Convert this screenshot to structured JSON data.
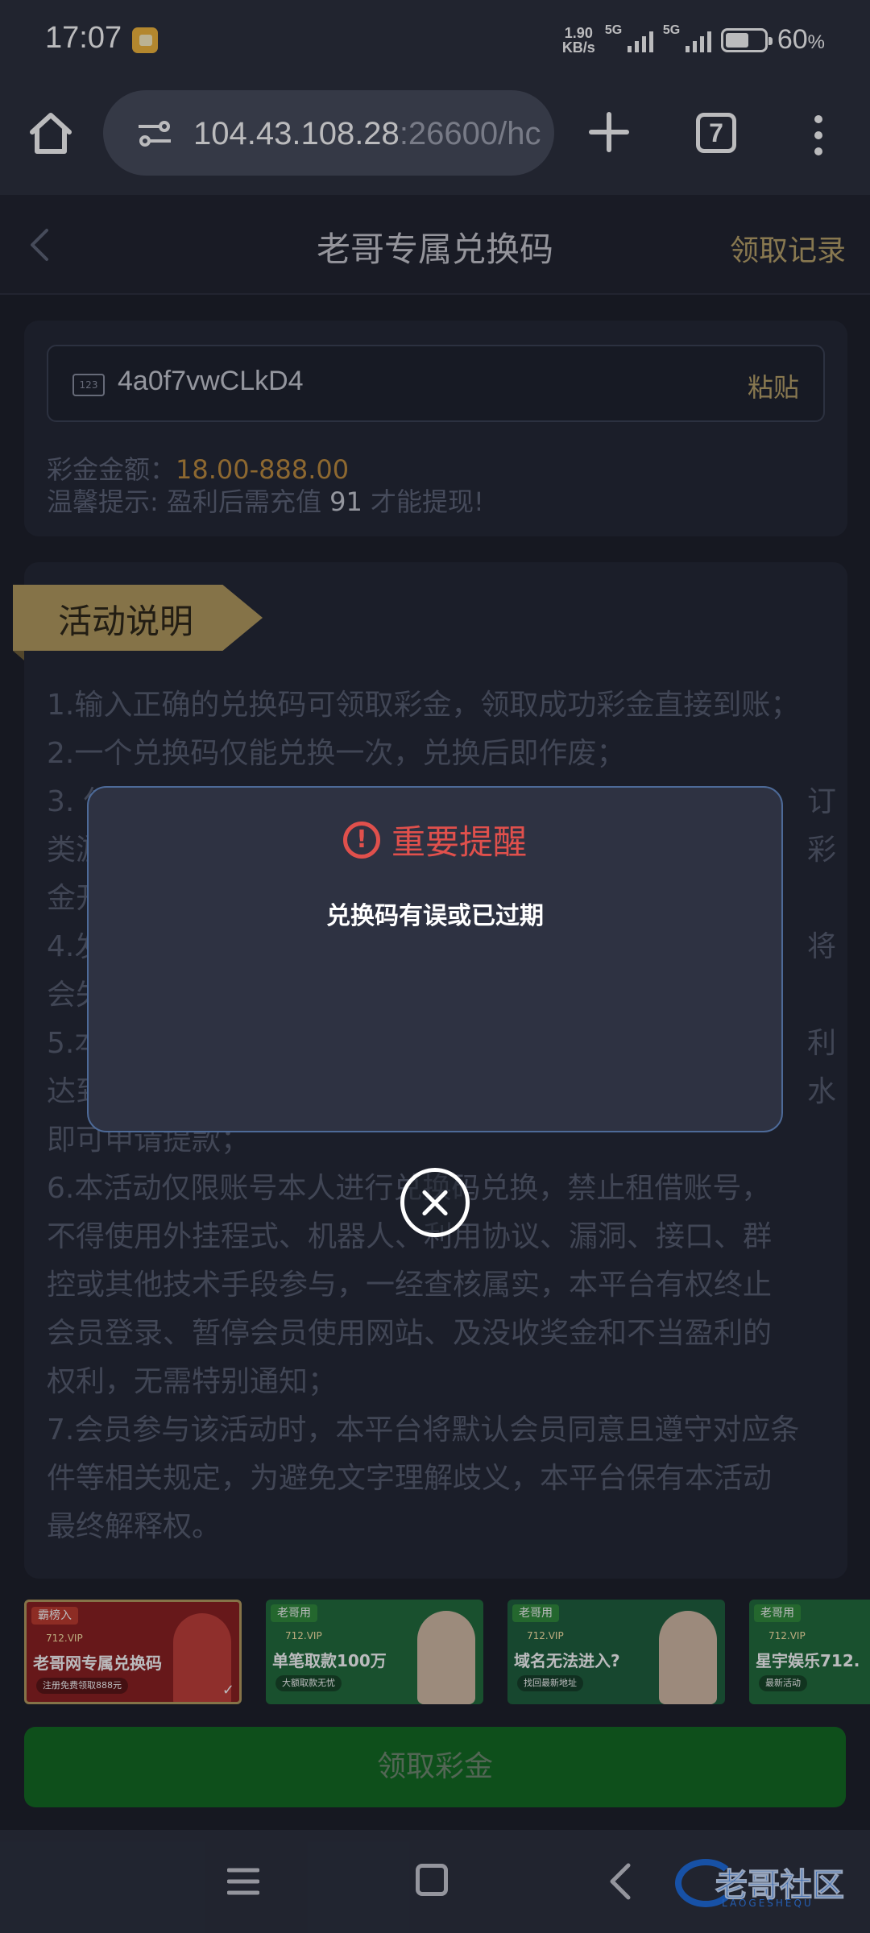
{
  "status_bar": {
    "time": "17:07",
    "net_speed_value": "1.90",
    "net_speed_unit": "KB/s",
    "signal1_label": "5G",
    "signal2_label": "5G",
    "battery_percent": "60",
    "battery_unit": "%"
  },
  "browser": {
    "url_host": "104.43.108.28",
    "url_rest": ":26600/hc",
    "tab_count": "7"
  },
  "header": {
    "title": "老哥专属兑换码",
    "records_link": "领取记录"
  },
  "code_card": {
    "icon_text": "123",
    "code_value": "4a0f7vwCLkD4",
    "paste_label": "粘贴",
    "amount_label": "彩金金额：",
    "amount_value": "18.00-888.00",
    "tip_prefix": "温馨提示: 盈利后需充值 ",
    "tip_number": "91",
    "tip_suffix": " 才能提现!"
  },
  "activity": {
    "ribbon_title": "活动说明",
    "rules": [
      "1.输入正确的兑换码可领取彩金，领取成功彩金直接到账；",
      "2.一个兑换码仅能兑换一次，兑换后即作废；",
      "3. 使",
      "类游",
      "金开",
      "4.发",
      "会失",
      "5.本",
      "达到",
      "即可申请提款；",
      "6.本活动仅限账号本人进行兑换码兑换，禁止租借账号，",
      "不得使用外挂程式、机器人、利用协议、漏洞、接口、群",
      "控或其他技术手段参与，一经查核属实，本平台有权终止",
      "会员登录、暂停会员使用网站、及没收奖金和不当盈利的",
      "权利，无需特别通知；",
      "7.会员参与该活动时，本平台将默认会员同意且遵守对应条",
      "件等相关规定，为避免文字理解歧义，本平台保有本活动",
      "最终解释权。"
    ],
    "rule_right_fragments": [
      "订",
      "彩",
      "将",
      "利",
      "水"
    ]
  },
  "thumbnails": [
    {
      "tag": "霸榜入",
      "site": "712.VIP",
      "headline": "老哥网专属兑换码",
      "sub": "注册免费领取888元",
      "tag_color": "#c0392b",
      "bg": "#8b1e1e"
    },
    {
      "tag": "老哥用",
      "site": "712.VIP",
      "headline": "单笔取款100万",
      "sub": "大额取款无忧",
      "tag_color": "#2e8b3a",
      "bg": "#1f6b3a"
    },
    {
      "tag": "老哥用",
      "site": "712.VIP",
      "headline": "域名无法进入?",
      "sub": "找回最新地址",
      "tag_color": "#2e8b3a",
      "bg": "#1d5f3b"
    },
    {
      "tag": "老哥用",
      "site": "712.VIP",
      "headline": "星宇娱乐712.",
      "sub": "最新活动",
      "tag_color": "#2e8b3a",
      "bg": "#1f6b3a"
    }
  ],
  "bottom": {
    "claim_button": "领取彩金"
  },
  "watermark": {
    "text": "老哥社区",
    "sub": "LAOGESHEQU"
  },
  "modal": {
    "title": "重要提醒",
    "alert_glyph": "!",
    "message": "兑换码有误或已过期"
  },
  "colors": {
    "accent_gold": "#b9a268",
    "amount_orange": "#c08d3c",
    "alert_red": "#e0504c",
    "claim_green": "#106a1f"
  }
}
